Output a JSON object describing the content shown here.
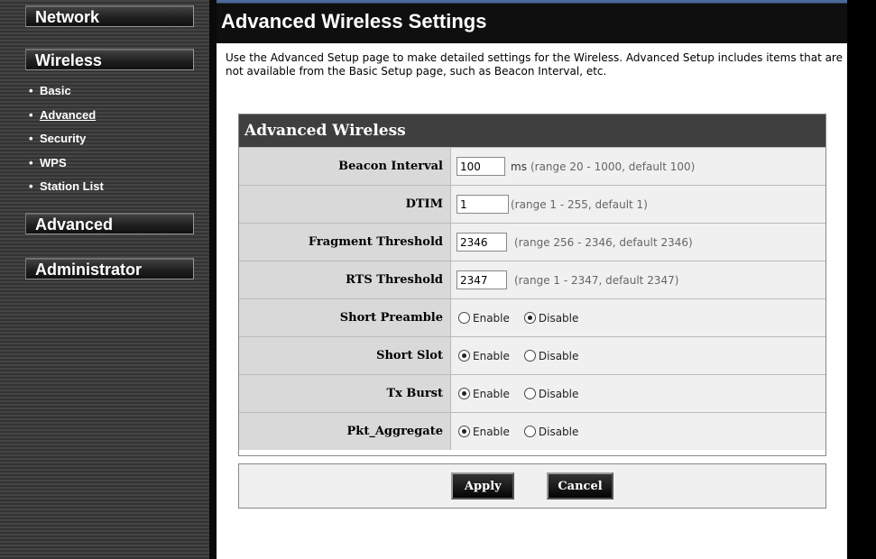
{
  "sidebar": {
    "menu": [
      "Network",
      "Wireless",
      "Advanced",
      "Administrator"
    ],
    "wireless_submenu": [
      {
        "label": "Basic",
        "active": false
      },
      {
        "label": "Advanced",
        "active": true
      },
      {
        "label": "Security",
        "active": false
      },
      {
        "label": "WPS",
        "active": false
      },
      {
        "label": "Station List",
        "active": false
      }
    ],
    "bullet": "•"
  },
  "page": {
    "title": "Advanced Wireless Settings",
    "intro": "Use the Advanced Setup page to make detailed settings for the Wireless. Advanced Setup includes items that are not available from the Basic Setup page, such as Beacon Interval, etc."
  },
  "form": {
    "section_title": "Advanced Wireless",
    "beacon_interval": {
      "label": "Beacon Interval",
      "value": "100",
      "unit": "ms",
      "hint": "(range 20 - 1000, default 100)"
    },
    "dtim": {
      "label": "DTIM",
      "value": "1",
      "hint": "(range 1 - 255, default 1)"
    },
    "fragment_threshold": {
      "label": "Fragment Threshold",
      "value": "2346",
      "hint": "(range 256 - 2346, default 2346)"
    },
    "rts_threshold": {
      "label": "RTS Threshold",
      "value": "2347",
      "hint": "(range 1 - 2347, default 2347)"
    },
    "enable_label": "Enable",
    "disable_label": "Disable",
    "short_preamble": {
      "label": "Short Preamble",
      "selected": "Disable"
    },
    "short_slot": {
      "label": "Short Slot",
      "selected": "Enable"
    },
    "tx_burst": {
      "label": "Tx Burst",
      "selected": "Enable"
    },
    "pkt_aggregate": {
      "label": "Pkt_Aggregate",
      "selected": "Enable"
    }
  },
  "buttons": {
    "apply": "Apply",
    "cancel": "Cancel"
  },
  "colors": {
    "title_accent": "#4d6a9a",
    "header_bg": "#3f3f3f",
    "label_bg": "#d9d9d9",
    "field_bg": "#f0f0f0"
  }
}
